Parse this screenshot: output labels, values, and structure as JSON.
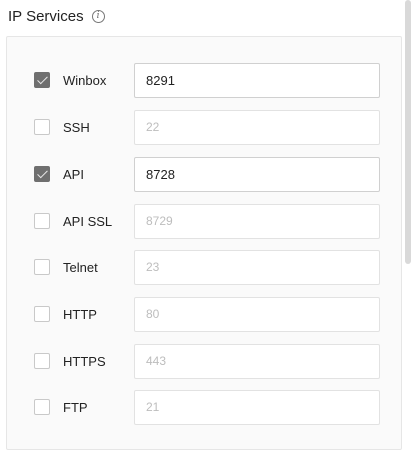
{
  "header": {
    "title": "IP Services",
    "info_icon": "info-icon"
  },
  "services": [
    {
      "name": "Winbox",
      "port": "8291",
      "enabled": true
    },
    {
      "name": "SSH",
      "port": "22",
      "enabled": false
    },
    {
      "name": "API",
      "port": "8728",
      "enabled": true
    },
    {
      "name": "API SSL",
      "port": "8729",
      "enabled": false
    },
    {
      "name": "Telnet",
      "port": "23",
      "enabled": false
    },
    {
      "name": "HTTP",
      "port": "80",
      "enabled": false
    },
    {
      "name": "HTTPS",
      "port": "443",
      "enabled": false
    },
    {
      "name": "FTP",
      "port": "21",
      "enabled": false
    }
  ],
  "colors": {
    "checked": "#6f6f6f",
    "disabled_text": "#bdbdbd"
  }
}
